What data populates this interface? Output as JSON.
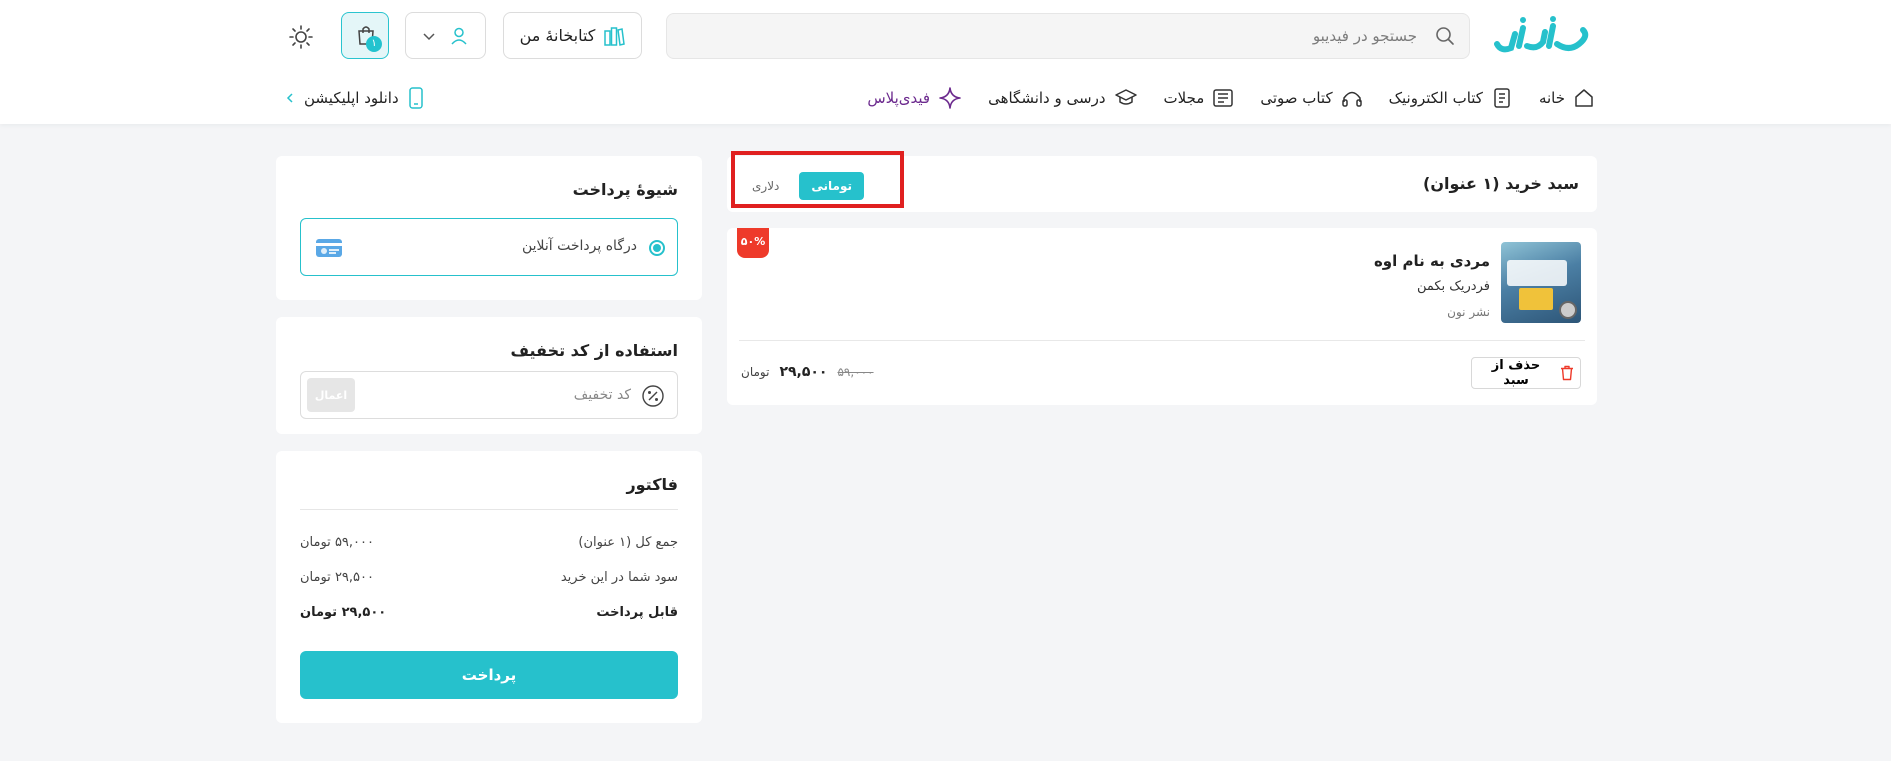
{
  "colors": {
    "accent": "#26c1cc",
    "plus": "#6c2a8e",
    "discount": "#ee3a2a",
    "highlight": "#e02020"
  },
  "header": {
    "logo_text": "فیدیبو",
    "search_placeholder": "جستجو در فیدیبو",
    "library_label": "کتابخانهٔ من",
    "cart_count": "۱"
  },
  "nav": {
    "items": [
      {
        "label": "خانه",
        "icon": "home-icon"
      },
      {
        "label": "کتاب الکترونیک",
        "icon": "ebook-icon"
      },
      {
        "label": "کتاب صوتی",
        "icon": "headphones-icon"
      },
      {
        "label": "مجلات",
        "icon": "magazine-icon"
      },
      {
        "label": "درسی و دانشگاهی",
        "icon": "graduation-cap-icon"
      },
      {
        "label": "فیدی‌پلاس",
        "icon": "sparkle-icon"
      }
    ],
    "download_app": "دانلود اپلیکیشن"
  },
  "cart": {
    "title": "سبد خرید (۱ عنوان)",
    "currency_toggle": {
      "active": "تومانی",
      "inactive": "دلاری"
    },
    "item": {
      "title": "مردی به نام اوه",
      "author": "فردریک بکمن",
      "publisher": "نشر نون",
      "discount": "۵۰%",
      "remove_label": "حذف از سبد",
      "old_price": "۵۹,۰۰۰",
      "price": "۲۹,۵۰۰",
      "unit": "تومان"
    }
  },
  "payment": {
    "title": "شیوهٔ پرداخت",
    "gateway_label": "درگاه پرداخت آنلاین"
  },
  "coupon": {
    "title": "استفاده از کد تخفیف",
    "placeholder": "کد تخفیف",
    "apply_label": "اعمال"
  },
  "invoice": {
    "title": "فاکتور",
    "rows": [
      {
        "label": "جمع کل (۱ عنوان)",
        "value": "۵۹,۰۰۰ تومان"
      },
      {
        "label": "سود شما در این خرید",
        "value": "۲۹,۵۰۰ تومان"
      },
      {
        "label": "قابل پرداخت",
        "value": "۲۹,۵۰۰ تومان"
      }
    ],
    "pay_label": "پرداخت"
  }
}
